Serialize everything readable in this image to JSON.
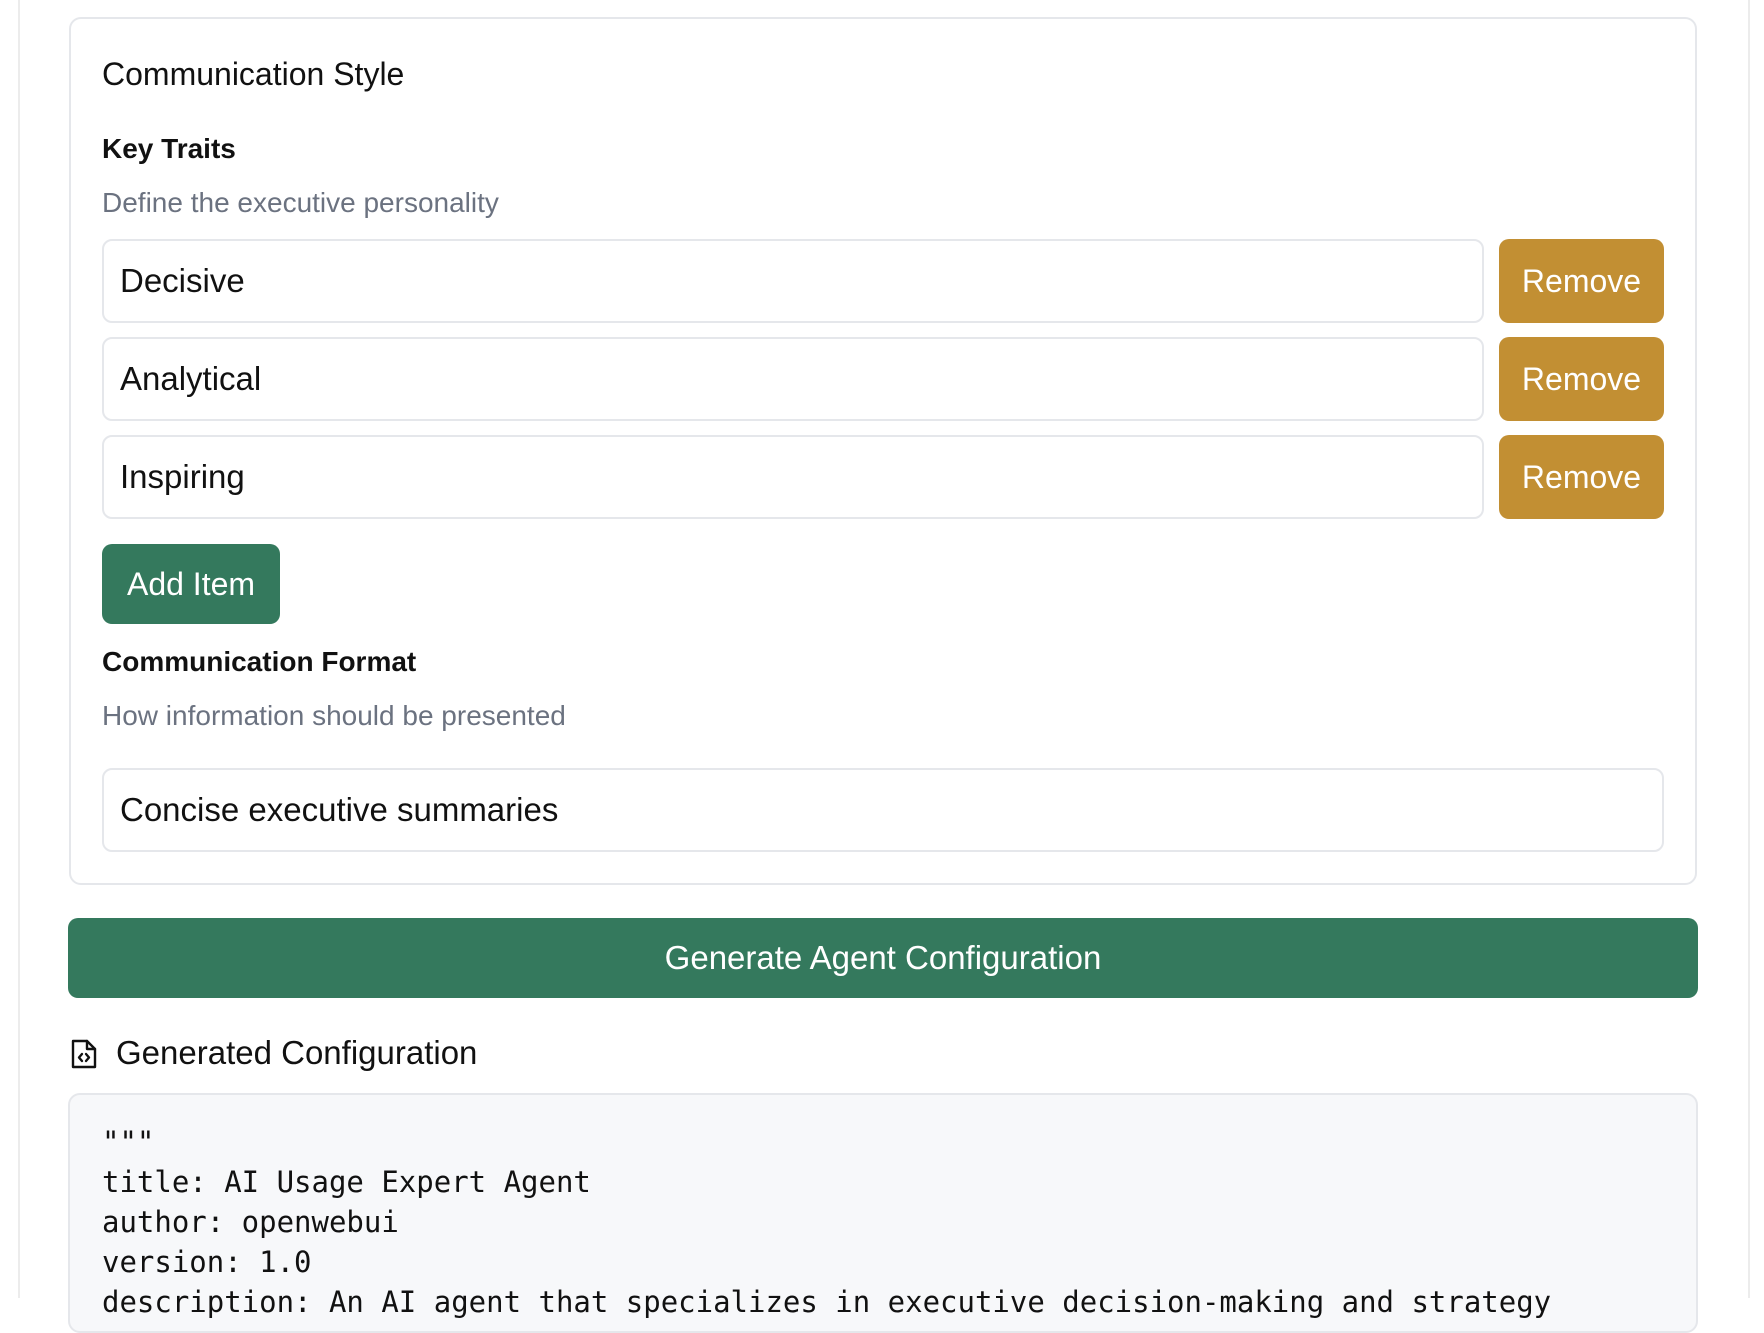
{
  "communication_style": {
    "title": "Communication Style",
    "key_traits": {
      "label": "Key Traits",
      "help": "Define the executive personality",
      "items": [
        {
          "value": "Decisive",
          "remove_label": "Remove"
        },
        {
          "value": "Analytical",
          "remove_label": "Remove"
        },
        {
          "value": "Inspiring",
          "remove_label": "Remove"
        }
      ],
      "add_label": "Add Item"
    },
    "format": {
      "label": "Communication Format",
      "help": "How information should be presented",
      "value": "Concise executive summaries"
    }
  },
  "generate_button": "Generate Agent Configuration",
  "generated": {
    "icon": "file-code-icon",
    "title": "Generated Configuration",
    "code_lines": [
      "\"\"\"",
      "title: AI Usage Expert Agent",
      "author: openwebui",
      "version: 1.0",
      "description: An AI agent that specializes in executive decision-making and strategy"
    ]
  },
  "colors": {
    "accent_green": "#34795d",
    "remove_gold": "#c28f33",
    "help_gray": "#6b7280"
  }
}
